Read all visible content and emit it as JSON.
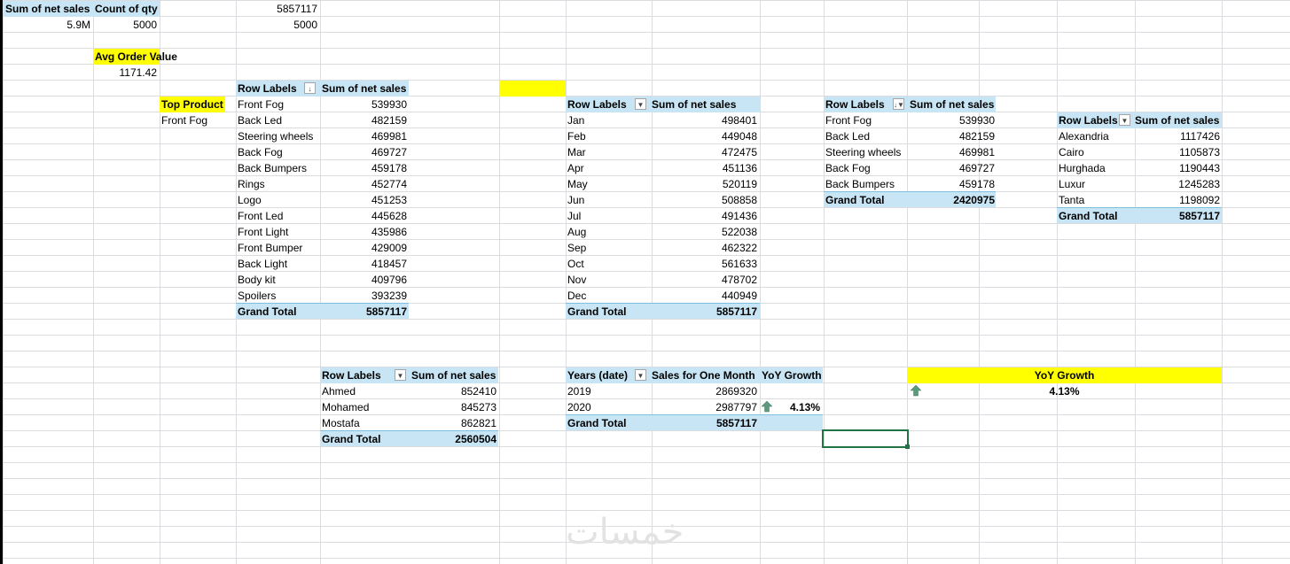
{
  "summary": {
    "h_sum": "Sum of net sales",
    "h_count": "Count of qty",
    "v_sum": "5.9M",
    "v_count": "5000",
    "raw_sum": "5857117",
    "raw_count": "5000"
  },
  "aov": {
    "label": "Avg Order Value",
    "value": "1171.42"
  },
  "top_product": {
    "label": "Top Product",
    "value": "Front Fog"
  },
  "products": {
    "h_row": "Row Labels",
    "h_val": "Sum of net sales",
    "rows": [
      {
        "label": "Front Fog",
        "value": "539930"
      },
      {
        "label": "Back Led",
        "value": "482159"
      },
      {
        "label": "Steering wheels",
        "value": "469981"
      },
      {
        "label": "Back Fog",
        "value": "469727"
      },
      {
        "label": "Back Bumpers",
        "value": "459178"
      },
      {
        "label": "Rings",
        "value": "452774"
      },
      {
        "label": "Logo",
        "value": "451253"
      },
      {
        "label": "Front Led",
        "value": "445628"
      },
      {
        "label": "Front Light",
        "value": "435986"
      },
      {
        "label": "Front Bumper",
        "value": "429009"
      },
      {
        "label": "Back Light",
        "value": "418457"
      },
      {
        "label": "Body kit",
        "value": "409796"
      },
      {
        "label": "Spoilers",
        "value": "393239"
      }
    ],
    "total_label": "Grand Total",
    "total_value": "5857117"
  },
  "months": {
    "h_row": "Row Labels",
    "h_val": "Sum of net sales",
    "rows": [
      {
        "label": "Jan",
        "value": "498401"
      },
      {
        "label": "Feb",
        "value": "449048"
      },
      {
        "label": "Mar",
        "value": "472475"
      },
      {
        "label": "Apr",
        "value": "451136"
      },
      {
        "label": "May",
        "value": "520119"
      },
      {
        "label": "Jun",
        "value": "508858"
      },
      {
        "label": "Jul",
        "value": "491436"
      },
      {
        "label": "Aug",
        "value": "522038"
      },
      {
        "label": "Sep",
        "value": "462322"
      },
      {
        "label": "Oct",
        "value": "561633"
      },
      {
        "label": "Nov",
        "value": "478702"
      },
      {
        "label": "Dec",
        "value": "440949"
      }
    ],
    "total_label": "Grand Total",
    "total_value": "5857117"
  },
  "top5": {
    "h_row": "Row Labels",
    "h_val": "Sum of net sales",
    "rows": [
      {
        "label": "Front Fog",
        "value": "539930"
      },
      {
        "label": "Back Led",
        "value": "482159"
      },
      {
        "label": "Steering wheels",
        "value": "469981"
      },
      {
        "label": "Back Fog",
        "value": "469727"
      },
      {
        "label": "Back Bumpers",
        "value": "459178"
      }
    ],
    "total_label": "Grand Total",
    "total_value": "2420975"
  },
  "cities": {
    "h_row": "Row Labels",
    "h_val": "Sum of net sales",
    "rows": [
      {
        "label": "Alexandria",
        "value": "1117426"
      },
      {
        "label": "Cairo",
        "value": "1105873"
      },
      {
        "label": "Hurghada",
        "value": "1190443"
      },
      {
        "label": "Luxur",
        "value": "1245283"
      },
      {
        "label": "Tanta",
        "value": "1198092"
      }
    ],
    "total_label": "Grand Total",
    "total_value": "5857117"
  },
  "reps": {
    "h_row": "Row Labels",
    "h_val": "Sum of net sales",
    "rows": [
      {
        "label": "Ahmed",
        "value": "852410"
      },
      {
        "label": "Mohamed",
        "value": "845273"
      },
      {
        "label": "Mostafa",
        "value": "862821"
      }
    ],
    "total_label": "Grand Total",
    "total_value": "2560504"
  },
  "years": {
    "h_row": "Years (date)",
    "h_val": "Sales for One Month",
    "h_growth": "YoY Growth",
    "rows": [
      {
        "label": "2019",
        "value": "2869320",
        "growth": ""
      },
      {
        "label": "2020",
        "value": "2987797",
        "growth": "4.13%"
      }
    ],
    "total_label": "Grand Total",
    "total_value": "5857117"
  },
  "yoy_card": {
    "title": "YoY Growth",
    "value": "4.13%"
  },
  "watermark": "خمسات",
  "colors": {
    "pivot_header": "#c7e5f4",
    "highlight": "#ffff00",
    "selection": "#217346",
    "arrow": "#5b9a7d"
  }
}
